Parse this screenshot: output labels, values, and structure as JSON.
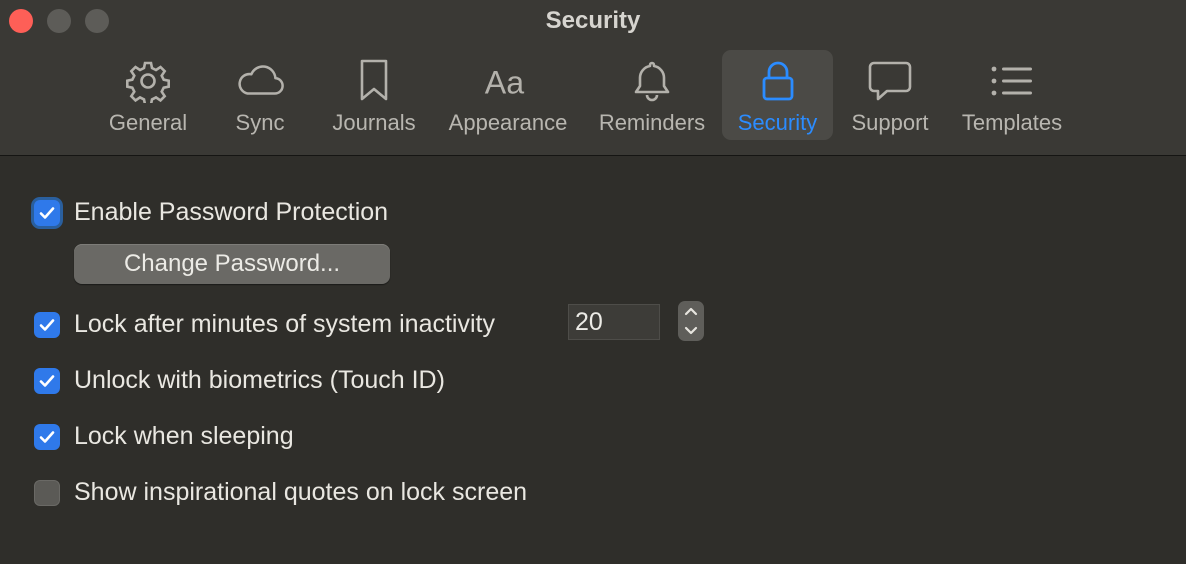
{
  "window": {
    "title": "Security"
  },
  "tabs": [
    {
      "label": "General",
      "icon": "gear-icon",
      "active": false
    },
    {
      "label": "Sync",
      "icon": "cloud-icon",
      "active": false
    },
    {
      "label": "Journals",
      "icon": "bookmark-icon",
      "active": false
    },
    {
      "label": "Appearance",
      "icon": "text-aa-icon",
      "active": false
    },
    {
      "label": "Reminders",
      "icon": "bell-icon",
      "active": false
    },
    {
      "label": "Security",
      "icon": "lock-icon",
      "active": true
    },
    {
      "label": "Support",
      "icon": "speech-bubble-icon",
      "active": false
    },
    {
      "label": "Templates",
      "icon": "list-icon",
      "active": false
    }
  ],
  "settings": {
    "enable_password": {
      "label": "Enable Password Protection",
      "checked": true
    },
    "change_password_button": "Change Password...",
    "lock_inactivity": {
      "label": "Lock after minutes of system inactivity",
      "checked": true,
      "minutes": "20"
    },
    "biometrics": {
      "label": "Unlock with biometrics (Touch ID)",
      "checked": true
    },
    "lock_sleeping": {
      "label": "Lock when sleeping",
      "checked": true
    },
    "inspirational_quotes": {
      "label": "Show inspirational quotes on lock screen",
      "checked": false
    }
  },
  "colors": {
    "accent": "#2b8cff",
    "checkbox_on": "#2f79ea",
    "close_light": "#fe5f57"
  }
}
